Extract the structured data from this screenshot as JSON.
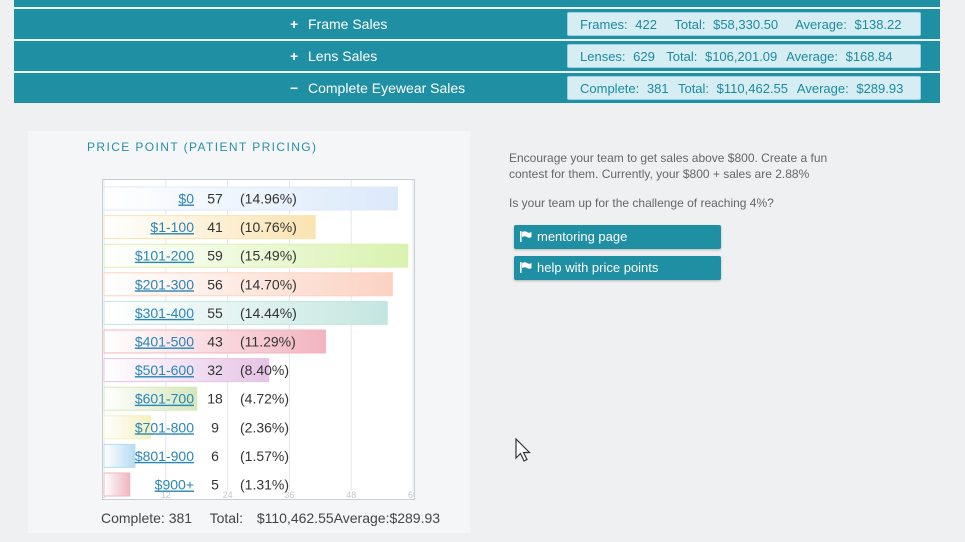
{
  "sales_rows": [
    {
      "sign": "+",
      "title": "Frame Sales",
      "count_label": "Frames:",
      "count": "422",
      "total_label": "Total:",
      "total": "$58,330.50",
      "avg_label": "Average:",
      "avg": "$138.22"
    },
    {
      "sign": "+",
      "title": "Lens Sales",
      "count_label": "Lenses:",
      "count": "629",
      "total_label": "Total:",
      "total": "$106,201.09",
      "avg_label": "Average:",
      "avg": "$168.84"
    },
    {
      "sign": "−",
      "title": "Complete Eyewear Sales",
      "count_label": "Complete:",
      "count": "381",
      "total_label": "Total:",
      "total": "$110,462.55",
      "avg_label": "Average:",
      "avg": "$289.93"
    }
  ],
  "chart_title": "Price Point (Patient Pricing)",
  "chart_data": {
    "type": "bar",
    "orientation": "horizontal",
    "title": "Price Point (Patient Pricing)",
    "categories": [
      "$0",
      "$1-100",
      "$101-200",
      "$201-300",
      "$301-400",
      "$401-500",
      "$501-600",
      "$601-700",
      "$701-800",
      "$801-900",
      "$900+"
    ],
    "values": [
      57,
      41,
      59,
      56,
      55,
      43,
      32,
      18,
      9,
      6,
      5
    ],
    "percent_labels": [
      "(14.96%)",
      "(10.76%)",
      "(15.49%)",
      "(14.70%)",
      "(14.44%)",
      "(11.29%)",
      "(8.40%)",
      "(4.72%)",
      "(2.36%)",
      "(1.57%)",
      "(1.31%)"
    ],
    "colors": [
      "#dbe9fa",
      "#fbe3b0",
      "#d9f2b0",
      "#fcd2c2",
      "#c4e6e0",
      "#f2b4bf",
      "#e6c3e6",
      "#d5e8bb",
      "#f5f0bd",
      "#b6dbf2",
      "#efb6c1"
    ],
    "x_ticks": [
      "0",
      "12",
      "24",
      "36",
      "48",
      "60"
    ],
    "xlim": [
      0,
      60
    ],
    "grid": true
  },
  "footer": {
    "complete_label": "Complete:",
    "complete_value": "381",
    "total_label": "Total:",
    "total_value": "$110,462.55",
    "avg_label": "Average:",
    "avg_value": "$289.93"
  },
  "info": {
    "text1": "Encourage your team to get sales above $800. Create a fun contest for them. Currently, your $800 + sales are 2.88%",
    "text2": "Is your team up for the challenge of reaching 4%?"
  },
  "buttons": {
    "mentoring": "mentoring page",
    "help": "help with price points"
  }
}
